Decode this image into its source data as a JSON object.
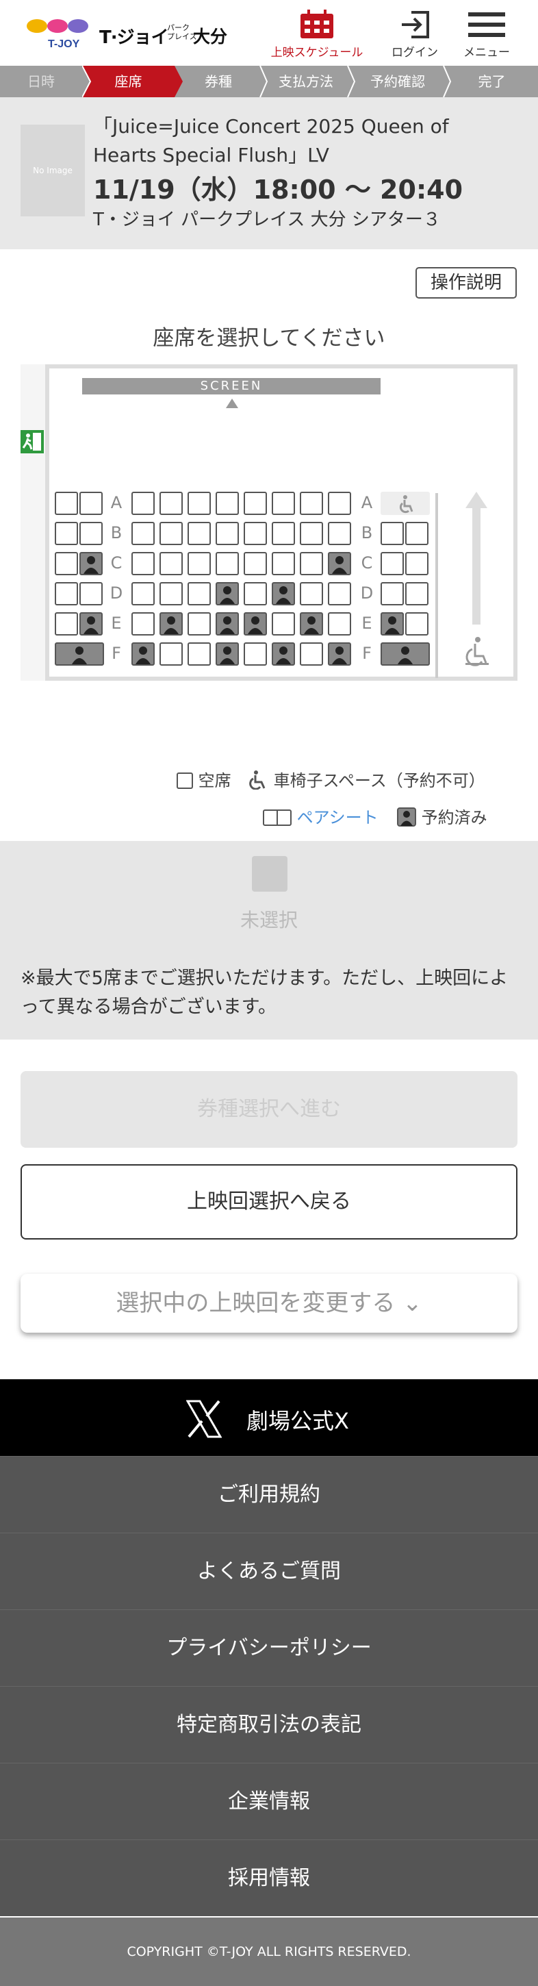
{
  "header": {
    "brand": "T·ジョイ",
    "brand_sub": "パーク\nプレイス",
    "brand_city": "大分",
    "schedule": "上映スケジュール",
    "login": "ログイン",
    "menu": "メニュー"
  },
  "steps": [
    "日時",
    "座席",
    "券種",
    "支払方法",
    "予約確認",
    "完了"
  ],
  "movie": {
    "thumb": "No Image",
    "title": "「Juice=Juice Concert 2025 Queen of Hearts Special Flush」LV",
    "datetime": "11/19（水）18:00 〜 20:40",
    "theater": "T・ジョイ パークプレイス 大分 シアター３"
  },
  "seat_section": {
    "help_button": "操作説明",
    "title": "座席を選択してください",
    "screen_label": "SCREEN",
    "rows": [
      "A",
      "B",
      "C",
      "D",
      "E",
      "F"
    ]
  },
  "legend": {
    "vacant": "空席",
    "wheelchair": "車椅子スペース（予約不可）",
    "pair": "ペアシート",
    "reserved": "予約済み"
  },
  "selection": {
    "status": "未選択",
    "note": "※最大で5席までご選択いただけます。ただし、上映回によって異なる場合がございます。"
  },
  "actions": {
    "next": "券種選択へ進む",
    "back": "上映回選択へ戻る",
    "change": "選択中の上映回を変更する ⌄"
  },
  "footer": {
    "x_label": "劇場公式X",
    "links": [
      "ご利用規約",
      "よくあるご質問",
      "プライバシーポリシー",
      "特定商取引法の表記",
      "企業情報",
      "採用情報"
    ],
    "copyright": "COPYRIGHT ©T-JOY ALL RIGHTS RESERVED."
  },
  "colors": {
    "accent": "#c0141e",
    "step_bg": "#9e9e9e",
    "reserved": "#888888",
    "pair_link": "#4a90d9"
  }
}
